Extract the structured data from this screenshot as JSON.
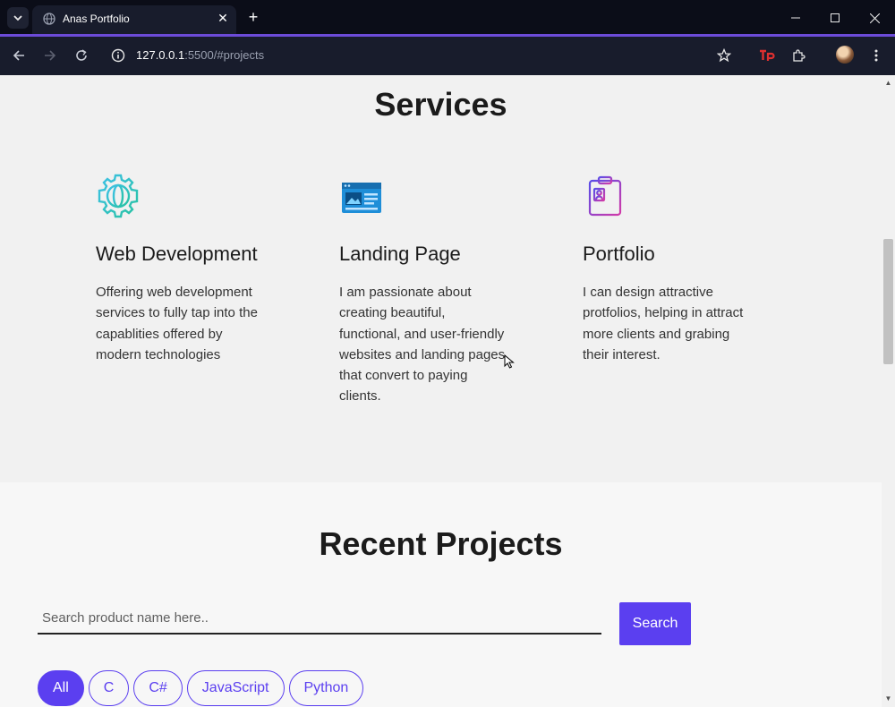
{
  "browser": {
    "tab_title": "Anas Portfolio",
    "tab_close": "✕",
    "new_tab": "+",
    "url_host": "127.0.0.1",
    "url_rest": ":5500/#projects",
    "accent_color": "#6c4bd8"
  },
  "services": {
    "title": "Services",
    "items": [
      {
        "icon": "globe-gear-icon",
        "title": "Web Development",
        "description": "Offering web development services to fully tap into the capablities offered by modern technologies"
      },
      {
        "icon": "browser-window-icon",
        "title": "Landing Page",
        "description": "I am passionate about creating beautiful, functional, and user-friendly websites and landing pages that convert to paying clients."
      },
      {
        "icon": "resume-clipboard-icon",
        "title": "Portfolio",
        "description": "I can design attractive protfolios, helping in attract more clients and grabing their interest."
      }
    ]
  },
  "projects": {
    "title": "Recent Projects",
    "search_placeholder": "Search product name here..",
    "search_label": "Search",
    "filters": [
      "All",
      "C",
      "C#",
      "JavaScript",
      "Python"
    ],
    "active_filter": "All",
    "accent_color": "#5b3ff0"
  }
}
